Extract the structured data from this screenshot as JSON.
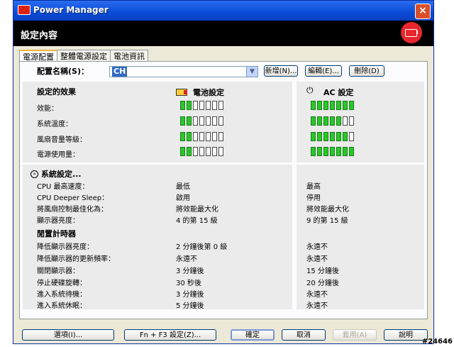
{
  "window": {
    "title": "Power Manager",
    "close_label": "×"
  },
  "header": {
    "title": "設定內容",
    "icon": "battery-plug-icon"
  },
  "tabs": [
    {
      "label": "電源配置",
      "active": true
    },
    {
      "label": "整體電源設定",
      "active": false
    },
    {
      "label": "電池資訊",
      "active": false
    }
  ],
  "profile": {
    "label": "配置名稱(S)：",
    "value": "CH",
    "new_button": "新增(N)...",
    "edit_button": "編輯(E)...",
    "delete_button": "刪除(D)"
  },
  "effects": {
    "heading": "設定的效果",
    "battery_header": "電池設定",
    "ac_header": "AC 設定",
    "rows": [
      {
        "label": "效能：",
        "battery_level": 2,
        "ac_level": 7
      },
      {
        "label": "系統溫度：",
        "battery_level": 2,
        "ac_level": 5
      },
      {
        "label": "風扇音量等級：",
        "battery_level": 2,
        "ac_level": 6
      },
      {
        "label": "電源使用量：",
        "battery_level": 2,
        "ac_level": 7
      }
    ],
    "max_level": 7
  },
  "system": {
    "heading": "系統設定...",
    "rows": [
      {
        "label": "CPU 最高速度：",
        "battery": "最低",
        "ac": "最高"
      },
      {
        "label": "CPU Deeper Sleep：",
        "battery": "啟用",
        "ac": "停用"
      },
      {
        "label": "將風扇控制最佳化為：",
        "battery": "將效能最大化",
        "ac": "將效能最大化"
      },
      {
        "label": "顯示器亮度：",
        "battery": "4 的第 15 級",
        "ac": "9 的第 15 級"
      }
    ]
  },
  "timers": {
    "heading": "閒置計時器",
    "rows": [
      {
        "label": "降低顯示器亮度：",
        "battery": "2 分鐘後第 0 級",
        "ac": "永遠不"
      },
      {
        "label": "降低顯示器的更新頻率：",
        "battery": "永遠不",
        "ac": "永遠不"
      },
      {
        "label": "關閉顯示器：",
        "battery": "3 分鐘後",
        "ac": "15 分鐘後"
      },
      {
        "label": "停止硬碟旋轉：",
        "battery": "30 秒後",
        "ac": "20 分鐘後"
      },
      {
        "label": "進入系統待機：",
        "battery": "3 分鐘後",
        "ac": "永遠不"
      },
      {
        "label": "進入系統休眠：",
        "battery": "5 分鐘後",
        "ac": "永遠不"
      }
    ]
  },
  "footer": {
    "options": "選項(I)...",
    "fn_f3": "Fn + F3 設定(Z)...",
    "ok": "確定",
    "cancel": "取消",
    "apply": "套用(A)",
    "help": "說明"
  },
  "watermark": "#24646"
}
